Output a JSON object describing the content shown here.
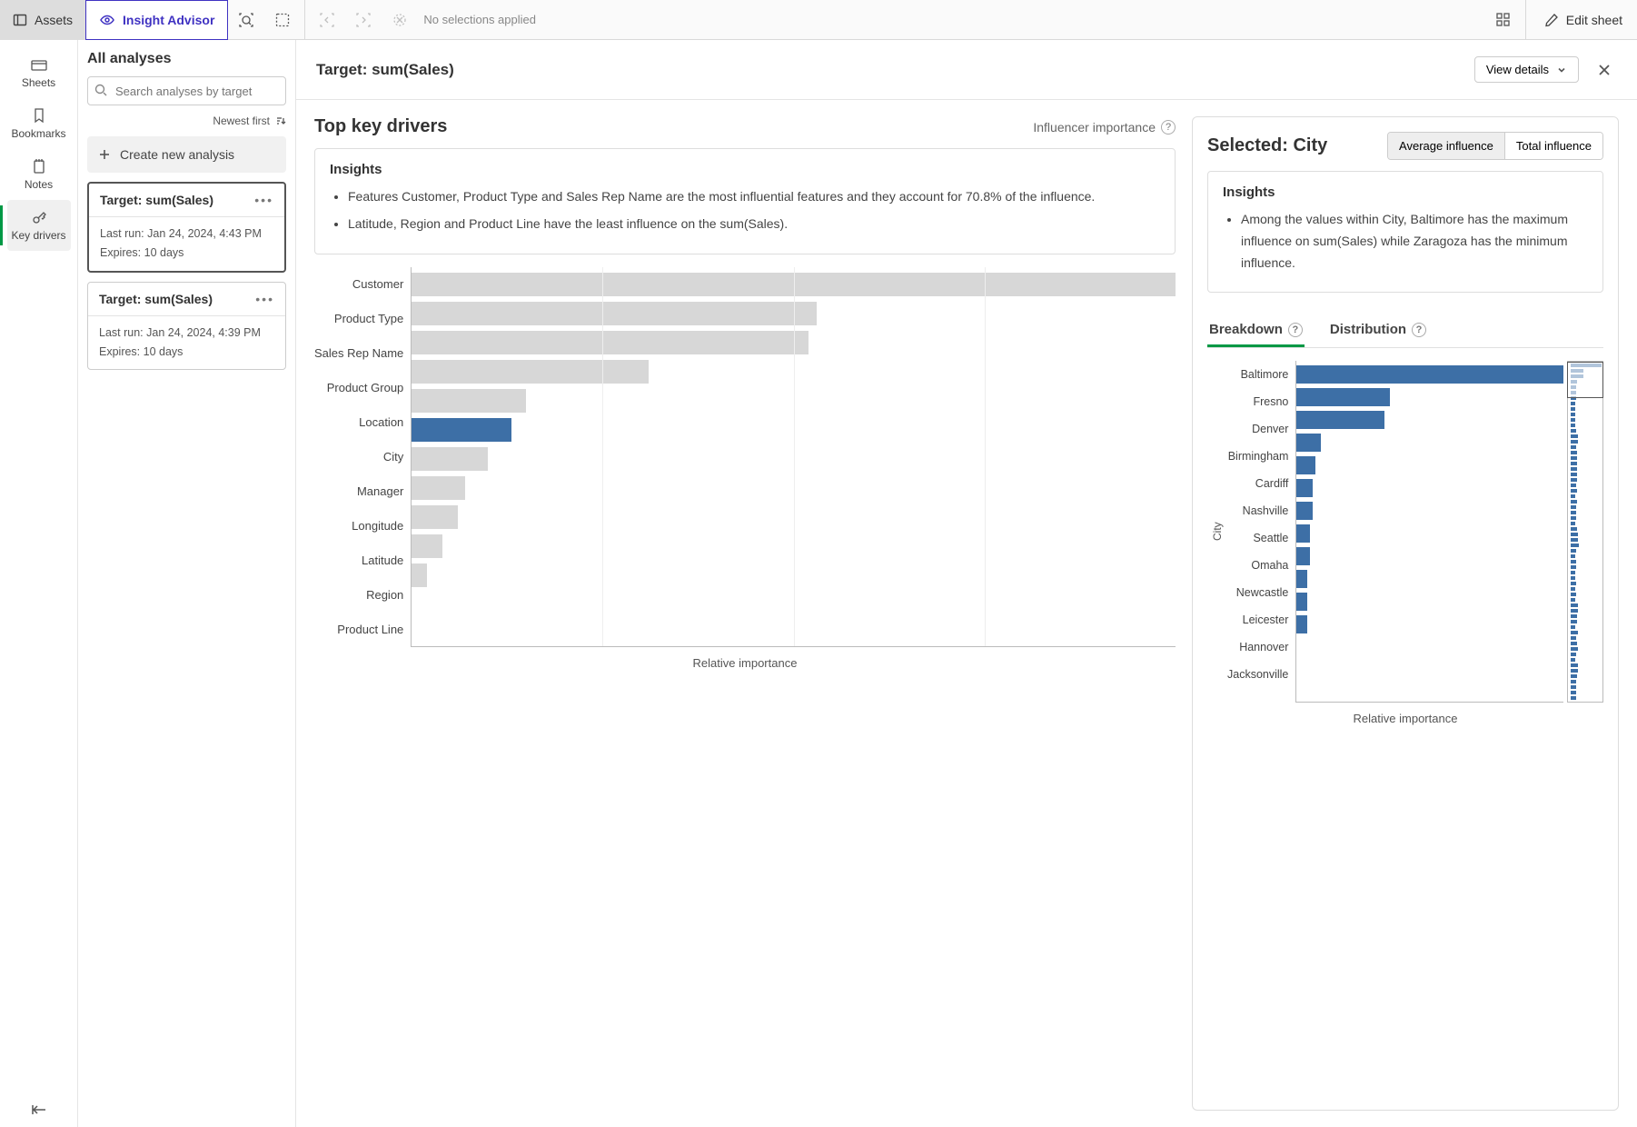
{
  "topbar": {
    "assets": "Assets",
    "insight_advisor": "Insight Advisor",
    "no_selections": "No selections applied",
    "edit_sheet": "Edit sheet"
  },
  "rail": {
    "sheets": "Sheets",
    "bookmarks": "Bookmarks",
    "notes": "Notes",
    "key_drivers": "Key drivers"
  },
  "analyses": {
    "title": "All analyses",
    "search_placeholder": "Search analyses by target",
    "sort": "Newest first",
    "create": "Create new analysis",
    "cards": [
      {
        "title": "Target: sum(Sales)",
        "last_run": "Last run: Jan 24, 2024, 4:43 PM",
        "expires": "Expires: 10 days",
        "selected": true
      },
      {
        "title": "Target: sum(Sales)",
        "last_run": "Last run: Jan 24, 2024, 4:39 PM",
        "expires": "Expires: 10 days",
        "selected": false
      }
    ]
  },
  "main": {
    "target": "Target: sum(Sales)",
    "view_details": "View details"
  },
  "left_panel": {
    "title": "Top key drivers",
    "subtitle": "Influencer importance",
    "insights_title": "Insights",
    "insights": [
      "Features Customer, Product Type and Sales Rep Name are the most influential features and they account for 70.8% of the influence.",
      "Latitude, Region and Product Line have the least influence on the sum(Sales)."
    ],
    "axis_label": "Relative importance"
  },
  "right_panel": {
    "selected_prefix": "Selected: ",
    "selected_value": "City",
    "toggle_avg": "Average influence",
    "toggle_total": "Total influence",
    "insights_title": "Insights",
    "insights": [
      "Among the values within City, Baltimore has the maximum influence on sum(Sales) while Zaragoza has the minimum influence."
    ],
    "tab_breakdown": "Breakdown",
    "tab_distribution": "Distribution",
    "yaxis": "City",
    "axis_label": "Relative importance"
  },
  "chart_data": [
    {
      "type": "bar",
      "orientation": "horizontal",
      "title": "Top key drivers",
      "xlabel": "Relative importance",
      "ylabel": "",
      "categories": [
        "Customer",
        "Product Type",
        "Sales Rep Name",
        "Product Group",
        "Location",
        "City",
        "Manager",
        "Longitude",
        "Latitude",
        "Region",
        "Product Line"
      ],
      "values": [
        100,
        53,
        52,
        31,
        15,
        13,
        10,
        7,
        6,
        4,
        2
      ],
      "highlight_index": 5,
      "xlim": [
        0,
        100
      ]
    },
    {
      "type": "bar",
      "orientation": "horizontal",
      "title": "Breakdown by City — Average influence",
      "xlabel": "Relative importance",
      "ylabel": "City",
      "categories": [
        "Baltimore",
        "Fresno",
        "Denver",
        "Birmingham",
        "Cardiff",
        "Nashville",
        "Seattle",
        "Omaha",
        "Newcastle",
        "Leicester",
        "Hannover",
        "Jacksonville"
      ],
      "values": [
        100,
        35,
        33,
        9,
        7,
        6,
        6,
        5,
        5,
        4,
        4,
        4
      ],
      "xlim": [
        0,
        100
      ]
    }
  ]
}
